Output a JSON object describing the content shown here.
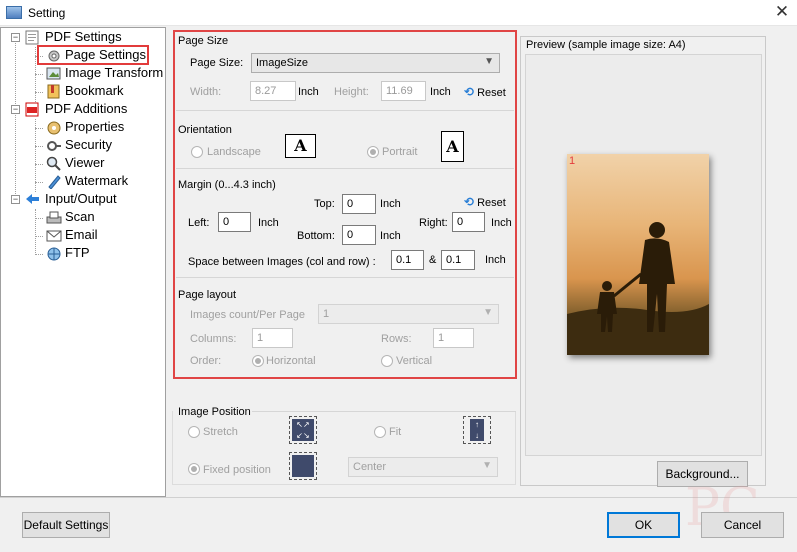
{
  "window": {
    "title": "Setting",
    "close_glyph": "✕"
  },
  "tree": {
    "items": [
      {
        "label": "PDF Settings",
        "icon": "pdf-settings-icon",
        "level": 0,
        "expander": "−"
      },
      {
        "label": "Page Settings",
        "icon": "gear-icon",
        "level": 1,
        "selected": true
      },
      {
        "label": "Image Transform",
        "icon": "image-transform-icon",
        "level": 1
      },
      {
        "label": "Bookmark",
        "icon": "bookmark-icon",
        "level": 1
      },
      {
        "label": "PDF Additions",
        "icon": "pdf-additions-icon",
        "level": 0,
        "expander": "−"
      },
      {
        "label": "Properties",
        "icon": "properties-icon",
        "level": 1
      },
      {
        "label": "Security",
        "icon": "security-icon",
        "level": 1
      },
      {
        "label": "Viewer",
        "icon": "viewer-icon",
        "level": 1
      },
      {
        "label": "Watermark",
        "icon": "watermark-icon",
        "level": 1
      },
      {
        "label": "Input/Output",
        "icon": "input-output-icon",
        "level": 0,
        "expander": "−"
      },
      {
        "label": "Scan",
        "icon": "scan-icon",
        "level": 1
      },
      {
        "label": "Email",
        "icon": "email-icon",
        "level": 1
      },
      {
        "label": "FTP",
        "icon": "ftp-icon",
        "level": 1
      }
    ]
  },
  "page_size": {
    "group_title": "Page Size",
    "label": "Page Size:",
    "value": "ImageSize",
    "width_label": "Width:",
    "width_value": "8.27",
    "height_label": "Height:",
    "height_value": "11.69",
    "unit": "Inch",
    "reset_label": "Reset"
  },
  "orientation": {
    "group_title": "Orientation",
    "landscape_label": "Landscape",
    "portrait_label": "Portrait",
    "selected": "portrait",
    "icon_letter": "A"
  },
  "margin": {
    "group_title": "Margin (0...4.3 inch)",
    "top_label": "Top:",
    "top_value": "0",
    "left_label": "Left:",
    "left_value": "0",
    "right_label": "Right:",
    "right_value": "0",
    "bottom_label": "Bottom:",
    "bottom_value": "0",
    "unit": "Inch",
    "reset_label": "Reset",
    "space_label": "Space between Images (col and row) :",
    "space_col": "0.1",
    "space_and": "&",
    "space_row": "0.1"
  },
  "page_layout": {
    "group_title": "Page layout",
    "count_label": "Images count/Per Page",
    "count_value": "1",
    "columns_label": "Columns:",
    "columns_value": "1",
    "rows_label": "Rows:",
    "rows_value": "1",
    "order_label": "Order:",
    "horizontal_label": "Horizontal",
    "vertical_label": "Vertical",
    "selected": "horizontal"
  },
  "image_position": {
    "group_title": "Image Position",
    "stretch_label": "Stretch",
    "fit_label": "Fit",
    "fixed_label": "Fixed position",
    "fixed_value": "Center",
    "selected": "fixed"
  },
  "preview": {
    "title": "Preview (sample image size: A4)",
    "page_number": "1",
    "background_button": "Background..."
  },
  "buttons": {
    "default_settings": "Default Settings",
    "ok": "OK",
    "cancel": "Cancel"
  },
  "colors": {
    "highlight_frame": "#e04545",
    "reset_icon": "#2a7fd6",
    "position_icon": "#3f4a6b"
  }
}
